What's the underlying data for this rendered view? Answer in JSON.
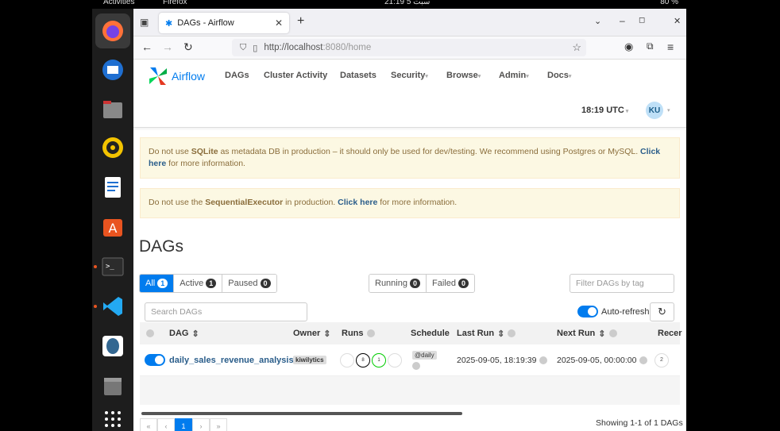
{
  "system": {
    "activities": "Activities",
    "app_name": "Firefox",
    "clock": "سبت 5 21:19",
    "battery": "80 %"
  },
  "browser": {
    "tab_title": "DAGs - Airflow",
    "url_prefix": "http://localhost",
    "url_rest": ":8080/home"
  },
  "header": {
    "brand": "Airflow",
    "menu": [
      "DAGs",
      "Cluster Activity",
      "Datasets",
      "Security",
      "Browse",
      "Admin",
      "Docs"
    ],
    "time": "18:19 UTC",
    "user_initials": "KU"
  },
  "alerts": [
    {
      "pre": "Do not use ",
      "bold": "SQLite",
      "mid": " as metadata DB in production – it should only be used for dev/testing. We recommend using Postgres or MySQL. ",
      "link": "Click here",
      "post": " for more information."
    },
    {
      "pre": "Do not use the ",
      "bold": "SequentialExecutor",
      "mid": " in production. ",
      "link": "Click here",
      "post": " for more information."
    }
  ],
  "page_title": "DAGs",
  "filters": {
    "all": {
      "label": "All",
      "count": "1"
    },
    "active": {
      "label": "Active",
      "count": "1"
    },
    "paused": {
      "label": "Paused",
      "count": "0"
    },
    "running": {
      "label": "Running",
      "count": "0"
    },
    "failed": {
      "label": "Failed",
      "count": "0"
    },
    "tag_placeholder": "Filter DAGs by tag",
    "search_placeholder": "Search DAGs",
    "autorefresh": "Auto-refresh"
  },
  "table": {
    "headers": {
      "dag": "DAG",
      "owner": "Owner",
      "runs": "Runs",
      "schedule": "Schedule",
      "last_run": "Last Run",
      "next_run": "Next Run",
      "recent": "Recer"
    },
    "rows": [
      {
        "dag_id": "daily_sales_revenue_analysis",
        "owner": "kiwilytics",
        "runs_a": "8",
        "runs_b": "1",
        "schedule": "@daily",
        "last_run": "2025-09-05, 18:19:39",
        "next_run": "2025-09-05, 00:00:00",
        "recent": "2"
      }
    ]
  },
  "pagination": {
    "first": "«",
    "prev": "‹",
    "current": "1",
    "next": "›",
    "last": "»"
  },
  "showing": "Showing 1-1 of 1 DAGs",
  "colors": {
    "accent": "#017cee",
    "alert_bg": "#fcf8e3"
  }
}
